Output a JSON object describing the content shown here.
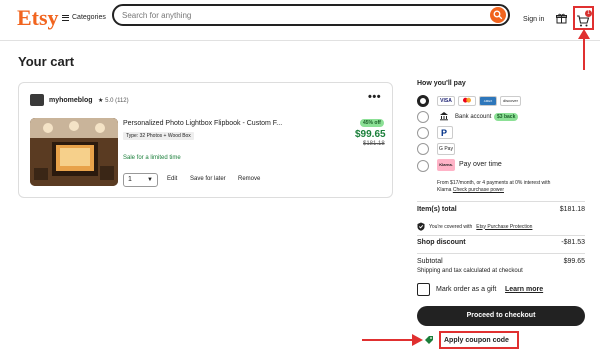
{
  "header": {
    "logo": "Etsy",
    "categories_label": "Categories",
    "search_placeholder": "Search for anything",
    "signin_label": "Sign in",
    "cart_count": "1"
  },
  "page": {
    "title": "Your cart"
  },
  "item": {
    "shop_name": "myhomeblog",
    "rating": "5.0",
    "reviews": "(112)",
    "title": "Personalized Photo Lightbox Flipbook - Custom F...",
    "variant": "Type: 32 Photos + Wood Box",
    "discount": "45% off",
    "price": "$99.65",
    "original_price": "$181.18",
    "sale_note": "Sale for a limited time",
    "quantity": "1",
    "actions": [
      "Edit",
      "Save for later",
      "Remove"
    ]
  },
  "payment": {
    "title": "How you'll pay",
    "cards": [
      "VISA",
      "AMEX",
      "discover"
    ],
    "bank_label": "Bank account",
    "bank_badge": "$3 back",
    "paypal": "PayPal",
    "gpay": "G Pay",
    "klarna_logo": "Klarna.",
    "klarna_label": "Pay over time",
    "klarna_note_1": "From $17/month, or 4 payments at 0% interest with",
    "klarna_note_2": "Klarna",
    "klarna_link": "Check purchase power"
  },
  "summary": {
    "items_label": "Item(s) total",
    "items_value": "$181.18",
    "protection_text": "You're covered with",
    "protection_link": "Etsy Purchase Protection",
    "discount_label": "Shop discount",
    "discount_value": "-$81.53",
    "subtotal_label": "Subtotal",
    "subtotal_value": "$99.65",
    "shipping_note": "Shipping and tax calculated at checkout",
    "gift_label": "Mark order as a gift",
    "learn_more": "Learn more",
    "checkout": "Proceed to checkout",
    "coupon": "Apply coupon code"
  },
  "colors": {
    "brand": "#f1641e",
    "sale_green": "#1a7f3a",
    "highlight_red": "#e03030"
  }
}
